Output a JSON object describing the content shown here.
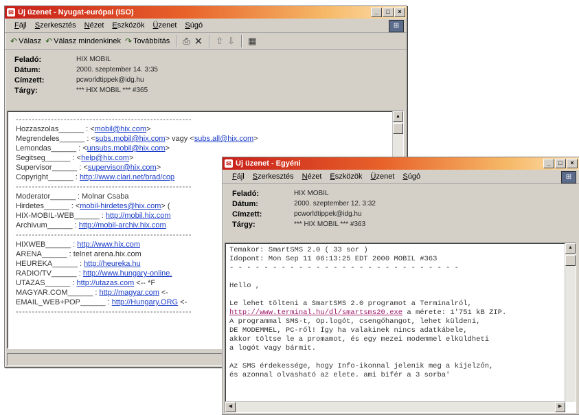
{
  "back_window": {
    "title": "Új üzenet - Nyugat-európai (ISO)",
    "menu": [
      "Fájl",
      "Szerkesztés",
      "Nézet",
      "Eszközök",
      "Üzenet",
      "Súgó"
    ],
    "toolbar": {
      "reply": "Válasz",
      "reply_all": "Válasz mindenkinek",
      "forward": "Továbbítás"
    },
    "headers": [
      {
        "key": "Feladó:",
        "value": "HIX MOBIL"
      },
      {
        "key": "Dátum:",
        "value": "2000. szeptember 14. 3:35"
      },
      {
        "key": "Címzett:",
        "value": "pcworldtippek@idg.hu"
      },
      {
        "key": "Tárgy:",
        "value": "*** HIX MOBIL *** #365"
      }
    ],
    "body_lines": [
      {
        "label": "Hozzaszolas______",
        "sep": " : <",
        "link": "mobil@hix.com",
        "after": ">"
      },
      {
        "label": "Megrendeles______",
        "sep": " : <",
        "link": "subs.mobil@hix.com",
        "after": ">  vagy <",
        "link2": "subs.all@hix.com",
        "after2": ">"
      },
      {
        "label": "Lemondas______",
        "sep": " : <",
        "link": "unsubs.mobil@hix.com",
        "after": ">"
      },
      {
        "label": "Segitseg______",
        "sep": " : <",
        "link": "help@hix.com",
        "after": ">"
      },
      {
        "label": "Supervisor______",
        "sep": " : <",
        "link": "supervisor@hix.com",
        "after": ">"
      },
      {
        "label": "Copyright______",
        "sep": " : ",
        "link": "http://www.clari.net/brad/cop",
        "after": ""
      },
      {
        "label": "Moderator______",
        "sep": " : Molnar Csaba",
        "link": "",
        "after": ""
      },
      {
        "label": "Hirdetes______",
        "sep": " : <",
        "link": "mobil-hirdetes@hix.com",
        "after": "> ("
      },
      {
        "label": "HIX-MOBIL-WEB______",
        "sep": " : ",
        "link": "http://mobil.hix.com",
        "after": ""
      },
      {
        "label": "Archivum______",
        "sep": " : ",
        "link": "http://mobil-archiv.hix.com",
        "after": ""
      },
      {
        "label": "HIXWEB______",
        "sep": " : ",
        "link": "http://www.hix.com",
        "after": ""
      },
      {
        "label": "ARENA______",
        "sep": " : telnet arena.hix.com",
        "link": "",
        "after": ""
      },
      {
        "label": "HEUREKA______",
        "sep": " : ",
        "link": "http://heureka.hu",
        "after": ""
      },
      {
        "label": "RADIO/TV______",
        "sep": " : ",
        "link": "http://www.hungary-online.",
        "after": ""
      },
      {
        "label": "UTAZAS______",
        "sep": " : ",
        "link": "http://utazas.com",
        "after": " <-- *F"
      },
      {
        "label": "MAGYAR.COM______",
        "sep": " : ",
        "link": "http://magyar.com",
        "after": " <-"
      },
      {
        "label": "EMAIL_WEB+POP______",
        "sep": " : ",
        "link": "http://Hungary.ORG",
        "after": " <-"
      }
    ]
  },
  "front_window": {
    "title": "Új üzenet - Egyéni",
    "menu": [
      "Fájl",
      "Szerkesztés",
      "Nézet",
      "Eszközök",
      "Üzenet",
      "Súgó"
    ],
    "headers": [
      {
        "key": "Feladó:",
        "value": "HIX MOBIL"
      },
      {
        "key": "Dátum:",
        "value": "2000. szeptember 12. 3:32"
      },
      {
        "key": "Címzett:",
        "value": "pcworldtippek@idg.hu"
      },
      {
        "key": "Tárgy:",
        "value": "*** HIX MOBIL *** #363"
      }
    ],
    "body_lines": [
      {
        "text": "Temakor: SmartSMS 2.0 ( 33 sor )"
      },
      {
        "text": "Idopont: Mon Sep 11 06:13:25 EDT 2000 MOBIL #363"
      },
      {
        "text": "- - - - - - - - - - - - - - - - - - - - - - - - - - -"
      },
      {
        "text": ""
      },
      {
        "text": "Hello ,"
      },
      {
        "text": ""
      },
      {
        "text": "Le lehet tölteni a SmartSMS 2.0 programot a Terminalról,"
      },
      {
        "link": "http://www.terminal.hu/dl/smartsms20.exe",
        "text": " a mérete: 1'751 kB ZIP."
      },
      {
        "text": "A programmal SMS-t, Op.logót, csengőhangot, lehet küldeni,"
      },
      {
        "text": "DE MODEMMEL, PC-ről! Így ha valakinek nincs adatkábele,"
      },
      {
        "text": "akkor töltse le a promamot, és egy mezei modemmel elküldheti"
      },
      {
        "text": "a logót vagy bármit."
      },
      {
        "text": ""
      },
      {
        "text": "Az SMS érdekessége, hogy Info-ikonnal jelenik meg a kijelzőn,"
      },
      {
        "text": "és azonnal olvasható az elete. ami bifér a 3 sorba'"
      }
    ]
  }
}
